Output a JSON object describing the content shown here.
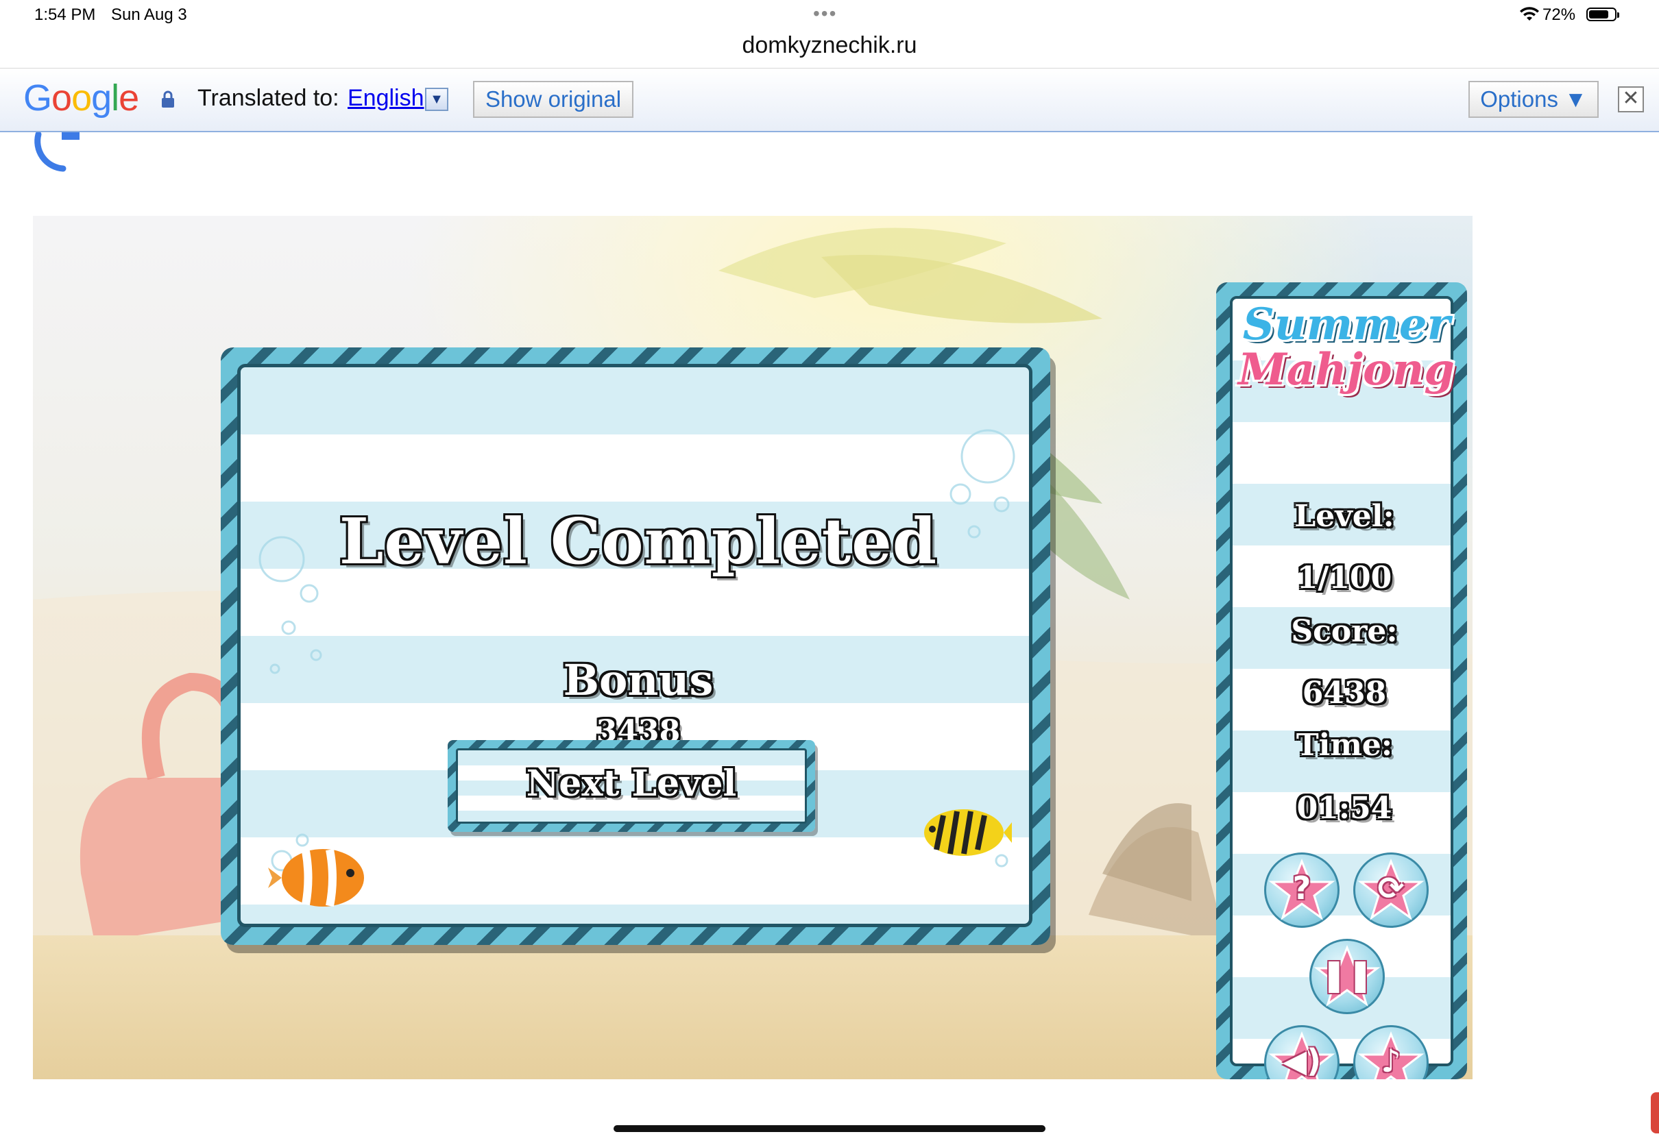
{
  "status_bar": {
    "time": "1:54 PM",
    "date": "Sun Aug 3",
    "battery_percent": "72%",
    "battery_level": 0.72
  },
  "browser": {
    "url": "domkyznechik.ru"
  },
  "translate_bar": {
    "logo": "Google",
    "translated_to_label": "Translated to:",
    "language": "English",
    "language_dropdown_icon": "dropdown-arrow-icon",
    "show_original_label": "Show original",
    "options_label": "Options ▼",
    "close_icon": "close-icon"
  },
  "game": {
    "logo_line1": "Summer",
    "logo_line2": "Mahjong",
    "dialog": {
      "title": "Level Completed",
      "bonus_label": "Bonus",
      "bonus_value": "3438",
      "next_button_label": "Next Level"
    },
    "panel": {
      "level_label": "Level:",
      "level_value": "1/100",
      "score_label": "Score:",
      "score_value": "6438",
      "time_label": "Time:",
      "time_value": "01:54"
    },
    "controls": [
      {
        "name": "help",
        "icon": "question-mark-icon"
      },
      {
        "name": "shuffle",
        "icon": "shuffle-icon"
      },
      {
        "name": "pause",
        "icon": "pause-icon"
      },
      {
        "name": "sound",
        "icon": "speaker-icon"
      },
      {
        "name": "music",
        "icon": "music-note-icon"
      }
    ],
    "colors": {
      "stripe_dark": "#2a6478",
      "stripe_light": "#6cc3d8",
      "row_tint": "#d6eef5",
      "star_pink": "#f07aa2"
    }
  }
}
